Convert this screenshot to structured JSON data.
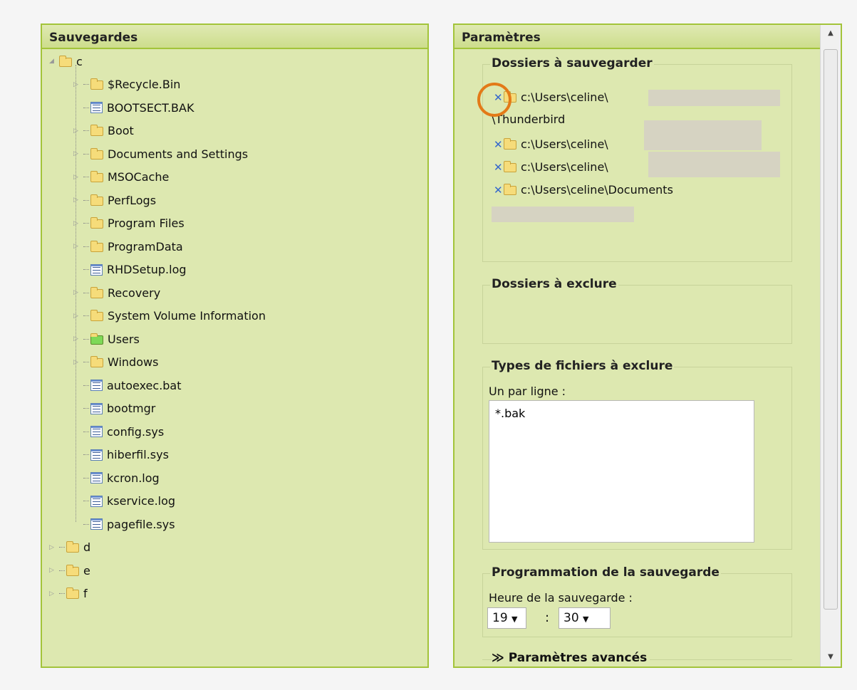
{
  "left": {
    "title": "Sauvegardes",
    "root": "c",
    "c_children": [
      {
        "label": "$Recycle.Bin",
        "type": "folder",
        "expand": true
      },
      {
        "label": "BOOTSECT.BAK",
        "type": "file",
        "expand": false
      },
      {
        "label": "Boot",
        "type": "folder",
        "expand": true
      },
      {
        "label": "Documents and Settings",
        "type": "folder",
        "expand": true
      },
      {
        "label": "MSOCache",
        "type": "folder",
        "expand": true
      },
      {
        "label": "PerfLogs",
        "type": "folder",
        "expand": true
      },
      {
        "label": "Program Files",
        "type": "folder",
        "expand": true
      },
      {
        "label": "ProgramData",
        "type": "folder",
        "expand": true
      },
      {
        "label": "RHDSetup.log",
        "type": "file",
        "expand": false
      },
      {
        "label": "Recovery",
        "type": "folder",
        "expand": true
      },
      {
        "label": "System Volume Information",
        "type": "folder",
        "expand": true
      },
      {
        "label": "Users",
        "type": "folder-open",
        "expand": true
      },
      {
        "label": "Windows",
        "type": "folder",
        "expand": true
      },
      {
        "label": "autoexec.bat",
        "type": "file",
        "expand": false
      },
      {
        "label": "bootmgr",
        "type": "file",
        "expand": false
      },
      {
        "label": "config.sys",
        "type": "file",
        "expand": false
      },
      {
        "label": "hiberfil.sys",
        "type": "file",
        "expand": false
      },
      {
        "label": "kcron.log",
        "type": "file",
        "expand": false
      },
      {
        "label": "kservice.log",
        "type": "file",
        "expand": false
      },
      {
        "label": "pagefile.sys",
        "type": "file",
        "expand": false
      }
    ],
    "drives": [
      "d",
      "e",
      "f"
    ]
  },
  "right": {
    "title": "Paramètres",
    "backup": {
      "legend": "Dossiers à sauvegarder",
      "entries": [
        "c:\\Users\\celine\\",
        "\\Thunderbird",
        "c:\\Users\\celine\\",
        "c:\\Users\\celine\\",
        "c:\\Users\\celine\\Documents"
      ]
    },
    "exclude": {
      "legend": "Dossiers à exclure"
    },
    "types": {
      "legend": "Types de fichiers à exclure",
      "label": "Un par ligne :",
      "value": "*.bak"
    },
    "schedule": {
      "legend": "Programmation de la sauvegarde",
      "label": "Heure de la sauvegarde :",
      "hour": "19",
      "sep": ":",
      "minute": "30"
    },
    "advanced": {
      "label": "Paramètres avancés"
    }
  }
}
